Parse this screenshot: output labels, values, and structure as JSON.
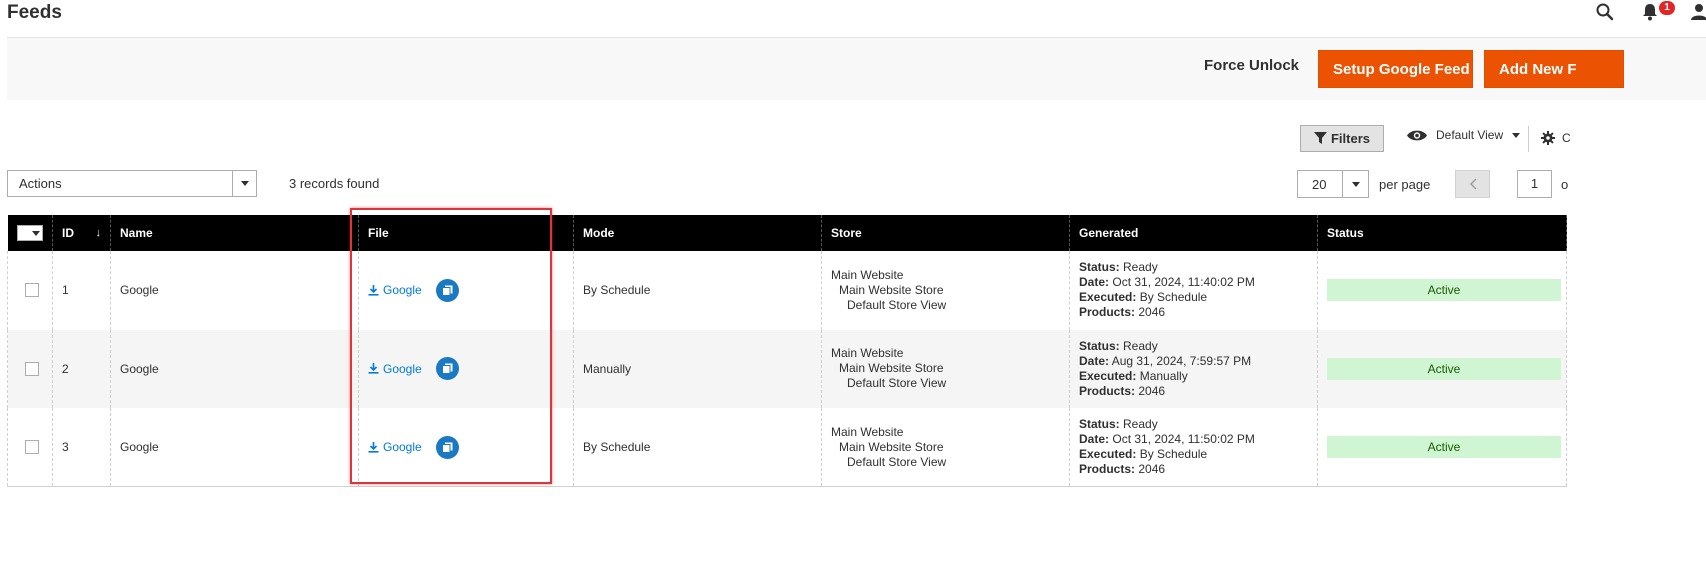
{
  "header": {
    "title": "Feeds",
    "notification_count": "1"
  },
  "actions": {
    "force_unlock": "Force Unlock",
    "setup_google_feed": "Setup Google Feed",
    "add_new": "Add New F"
  },
  "toolbar": {
    "filters": "Filters",
    "view": "Default View",
    "columns_partial": "C",
    "mass_action": "Actions",
    "records_found": "3 records found",
    "per_page_value": "20",
    "per_page_label": "per page",
    "page_value": "1",
    "page_of": "o"
  },
  "grid": {
    "columns": {
      "id": "ID",
      "name": "Name",
      "file": "File",
      "mode": "Mode",
      "store": "Store",
      "generated": "Generated",
      "status": "Status"
    },
    "rows": [
      {
        "id": "1",
        "name": "Google",
        "file": "Google",
        "mode": "By Schedule",
        "store": [
          "Main Website",
          "Main Website Store",
          "Default Store View"
        ],
        "gen_status_label": "Status:",
        "gen_status": "Ready",
        "gen_date_label": "Date:",
        "gen_date": "Oct 31, 2024, 11:40:02 PM",
        "gen_executed_label": "Executed:",
        "gen_executed": "By Schedule",
        "gen_products_label": "Products:",
        "gen_products": "2046",
        "status": "Active"
      },
      {
        "id": "2",
        "name": "Google",
        "file": "Google",
        "mode": "Manually",
        "store": [
          "Main Website",
          "Main Website Store",
          "Default Store View"
        ],
        "gen_status_label": "Status:",
        "gen_status": "Ready",
        "gen_date_label": "Date:",
        "gen_date": "Aug 31, 2024, 7:59:57 PM",
        "gen_executed_label": "Executed:",
        "gen_executed": "Manually",
        "gen_products_label": "Products:",
        "gen_products": "2046",
        "status": "Active"
      },
      {
        "id": "3",
        "name": "Google",
        "file": "Google",
        "mode": "By Schedule",
        "store": [
          "Main Website",
          "Main Website Store",
          "Default Store View"
        ],
        "gen_status_label": "Status:",
        "gen_status": "Ready",
        "gen_date_label": "Date:",
        "gen_date": "Oct 31, 2024, 11:50:02 PM",
        "gen_executed_label": "Executed:",
        "gen_executed": "By Schedule",
        "gen_products_label": "Products:",
        "gen_products": "2046",
        "status": "Active"
      }
    ]
  },
  "colors": {
    "accent": "#eb5202",
    "header_bg": "#000000",
    "link": "#007bdb",
    "status_active_bg": "#d0f5d2",
    "highlight": "#d9363e"
  },
  "icons": [
    "search-icon",
    "bell-icon",
    "user-icon",
    "filter-icon",
    "eye-icon",
    "gear-icon",
    "download-icon",
    "copy-icon",
    "chevron-down-icon",
    "chevron-left-icon",
    "sort-arrow-icon"
  ]
}
